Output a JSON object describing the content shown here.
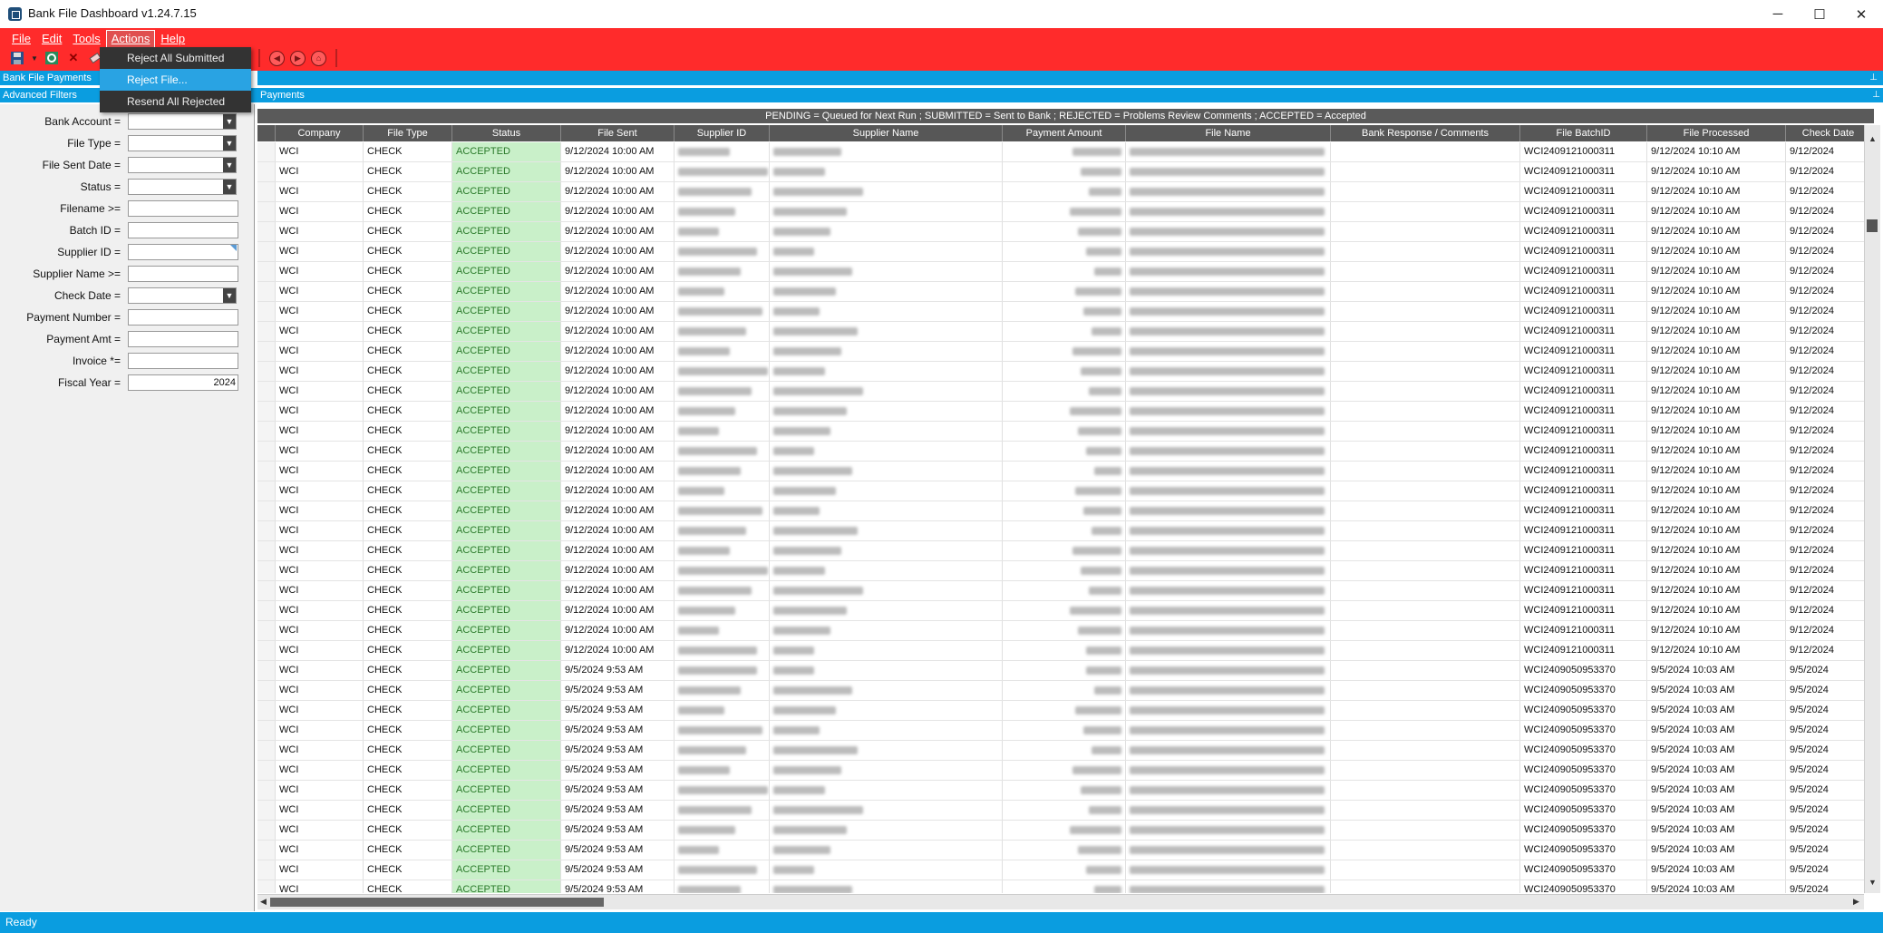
{
  "window": {
    "title": "Bank File Dashboard v1.24.7.15",
    "minimize": "─",
    "maximize": "☐",
    "close": "✕"
  },
  "menu": [
    {
      "label": "File"
    },
    {
      "label": "Edit"
    },
    {
      "label": "Tools"
    },
    {
      "label": "Actions"
    },
    {
      "label": "Help"
    }
  ],
  "actions_menu": [
    {
      "label": "Reject All Submitted",
      "selected": false
    },
    {
      "label": "Reject File...",
      "selected": true
    },
    {
      "label": "Resend All Rejected",
      "selected": false
    }
  ],
  "toolbar_icons": [
    "save-icon",
    "dropdown-arrow-icon",
    "refresh-icon",
    "delete-icon",
    "eraser-icon",
    "back-icon",
    "forward-icon",
    "home-icon"
  ],
  "left_tabs": {
    "bank_file_payments": "Bank File Payments",
    "advanced_filters": "Advanced Filters"
  },
  "payments_header": "Payments",
  "filters": [
    {
      "label": "Bank Account =",
      "type": "combo",
      "value": ""
    },
    {
      "label": "File Type =",
      "type": "combo",
      "value": ""
    },
    {
      "label": "File Sent Date =",
      "type": "combo",
      "value": ""
    },
    {
      "label": "Status =",
      "type": "combo",
      "value": ""
    },
    {
      "label": "Filename >=",
      "type": "text",
      "value": ""
    },
    {
      "label": "Batch ID =",
      "type": "text",
      "value": ""
    },
    {
      "label": "Supplier ID =",
      "type": "text",
      "value": ""
    },
    {
      "label": "Supplier Name >=",
      "type": "text",
      "value": ""
    },
    {
      "label": "Check Date =",
      "type": "combo",
      "value": ""
    },
    {
      "label": "Payment Number =",
      "type": "text",
      "value": ""
    },
    {
      "label": "Payment Amt =",
      "type": "text",
      "value": ""
    },
    {
      "label": "Invoice *=",
      "type": "text",
      "value": ""
    },
    {
      "label": "Fiscal Year =",
      "type": "text",
      "value": "2024"
    }
  ],
  "legend": "PENDING = Queued for Next Run ; SUBMITTED = Sent to Bank ; REJECTED = Problems Review Comments ; ACCEPTED = Accepted",
  "columns": [
    "Company",
    "File Type",
    "Status",
    "File Sent",
    "Supplier ID",
    "Supplier Name",
    "Payment Amount",
    "File Name",
    "Bank Response / Comments",
    "File BatchID",
    "File Processed",
    "Check Date"
  ],
  "batches": [
    {
      "rows": 26,
      "company": "WCI",
      "file_type": "CHECK",
      "status": "ACCEPTED",
      "file_sent": "9/12/2024 10:00 AM",
      "batch_id": "WCI2409121000311",
      "processed": "9/12/2024 10:10 AM",
      "check_date": "9/12/2024"
    },
    {
      "rows": 14,
      "company": "WCI",
      "file_type": "CHECK",
      "status": "ACCEPTED",
      "file_sent": "9/5/2024 9:53 AM",
      "batch_id": "WCI2409050953370",
      "processed": "9/5/2024 10:03 AM",
      "check_date": "9/5/2024"
    }
  ],
  "status_text": "Ready"
}
